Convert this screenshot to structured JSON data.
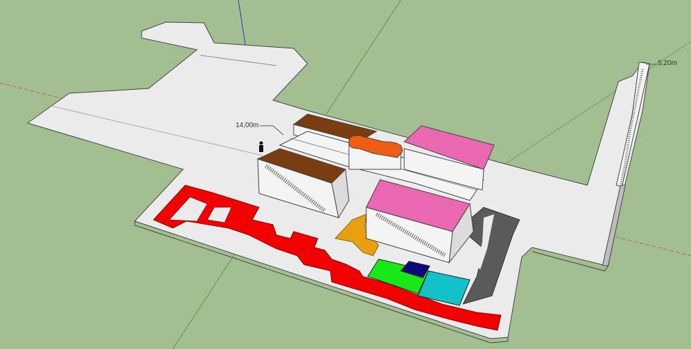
{
  "viewport": {
    "background_color": "#a3bf92",
    "axes": {
      "red": "#d04040",
      "green": "#2f9a2f",
      "blue": "#3030c8"
    }
  },
  "model": {
    "slab_color": "#ebebeb",
    "wall_color": "#f4f4f4",
    "edge_color": "#444444",
    "roof_brown": "#7a3d12",
    "roof_pink": "#ea67b2",
    "roof_orange": "#ee5d14",
    "path_red": "#f20000",
    "path_orange": "#e8a010",
    "path_dark": "#5a5a5a",
    "zone_green": "#18e818",
    "zone_navy": "#0a0a78",
    "zone_cyan": "#12c2c8"
  },
  "dimensions": {
    "height_label": "14,00m",
    "width_label": "5,20m"
  },
  "icons": {
    "figure": "human-scale-figure-icon"
  }
}
